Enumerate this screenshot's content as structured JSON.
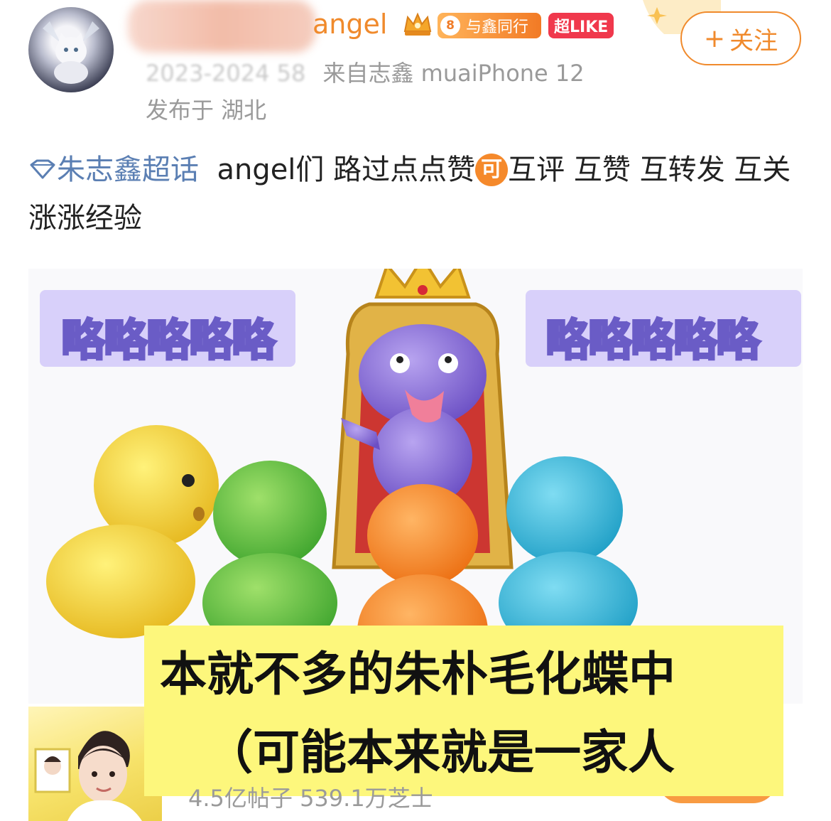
{
  "post": {
    "username": "angel",
    "level_badge": {
      "level": "8",
      "label": "与鑫同行"
    },
    "like_badge": "超LIKE",
    "time": "2023-2024 58",
    "source": "来自志鑫 muaiPhone 12",
    "location": "发布于 湖北",
    "follow_label": "关注",
    "follow_plus": "+",
    "text": {
      "topic": "朱志鑫超话",
      "before_emoji": "angel们 路过点点赞",
      "emoji": "可",
      "after_emoji": "互评 互赞 互转发 互关 涨涨经验"
    }
  },
  "image": {
    "sign_left": "略略略略略",
    "sign_right": "略略略略略",
    "caption_line1": "本就不多的朱朴毛化蝶中",
    "caption_line2": "（可能本来就是一家人"
  },
  "topic_card": {
    "stats": "4.5亿帖子 539.1万芝士"
  },
  "icons": {
    "topic": "diamond-topic-icon",
    "crown": "crown-badge-icon"
  },
  "colors": {
    "accent_orange": "#f08a2c",
    "topic_blue": "#5b7fb3",
    "like_red": "#f0384c",
    "caption_yellow": "#fdf77c"
  }
}
